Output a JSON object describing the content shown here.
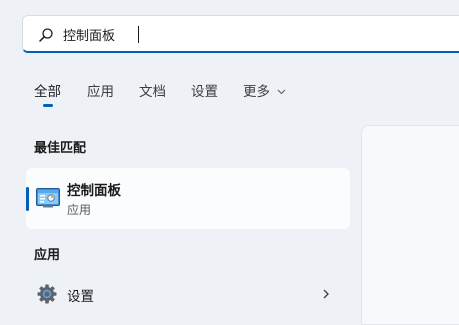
{
  "search": {
    "value": "控制面板",
    "placeholder": ""
  },
  "tabs": [
    {
      "label": "全部",
      "active": true
    },
    {
      "label": "应用",
      "active": false
    },
    {
      "label": "文档",
      "active": false
    },
    {
      "label": "设置",
      "active": false
    },
    {
      "label": "更多",
      "active": false
    }
  ],
  "best_match": {
    "section_title": "最佳匹配",
    "name": "控制面板",
    "subtitle": "应用",
    "icon": "control-panel-icon"
  },
  "apps": {
    "section_title": "应用",
    "items": [
      {
        "label": "设置",
        "icon": "gear-icon"
      }
    ]
  },
  "colors": {
    "accent": "#005fb8",
    "background": "#eef1f6",
    "card": "#fbfcfd"
  }
}
